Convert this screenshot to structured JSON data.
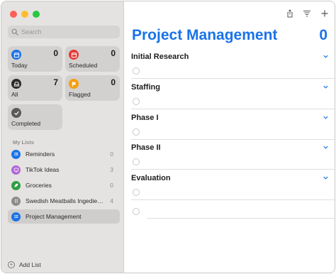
{
  "colors": {
    "accent": "#1a73e8",
    "today": "#1a73e8",
    "scheduled": "#e53935",
    "all": "#2b2b2b",
    "flagged": "#f59e0b",
    "completed": "#5a5a5a",
    "reminders": "#1a73e8",
    "tiktok": "#b065d8",
    "groceries": "#2e9e44",
    "swedish": "#8e8c8a",
    "project": "#1a73e8"
  },
  "search": {
    "placeholder": "Search",
    "icon": "search-icon"
  },
  "smart_lists": [
    {
      "label": "Today",
      "count": "0",
      "icon": "calendar-today-icon"
    },
    {
      "label": "Scheduled",
      "count": "0",
      "icon": "calendar-icon"
    },
    {
      "label": "All",
      "count": "7",
      "icon": "tray-icon"
    },
    {
      "label": "Flagged",
      "count": "0",
      "icon": "flag-icon"
    },
    {
      "label": "Completed",
      "count": "",
      "icon": "checkmark-icon"
    }
  ],
  "my_lists": {
    "header": "My Lists",
    "items": [
      {
        "name": "Reminders",
        "count": "0",
        "icon": "list-icon"
      },
      {
        "name": "TikTok Ideas",
        "count": "3",
        "icon": "tv-icon"
      },
      {
        "name": "Groceries",
        "count": "0",
        "icon": "leaf-icon"
      },
      {
        "name": "Swedish Meatballs Ingedien...",
        "count": "4",
        "icon": "utensils-icon"
      },
      {
        "name": "Project Management",
        "count": "",
        "icon": "list-icon"
      }
    ]
  },
  "add_list_label": "Add List",
  "main": {
    "title": "Project Management",
    "count": "0",
    "groups": [
      {
        "name": "Initial Research"
      },
      {
        "name": "Staffing"
      },
      {
        "name": "Phase I"
      },
      {
        "name": "Phase II"
      },
      {
        "name": "Evaluation"
      }
    ]
  }
}
